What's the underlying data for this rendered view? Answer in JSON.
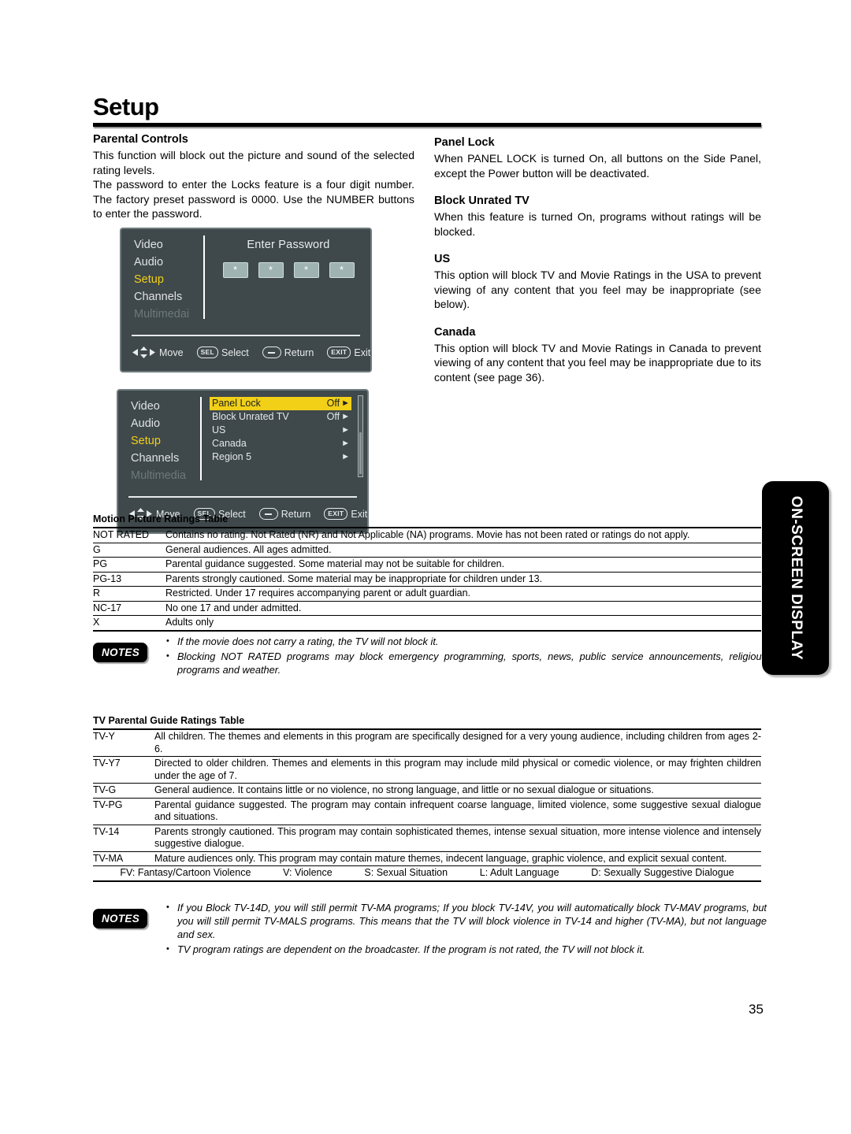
{
  "page": {
    "title": "Setup",
    "number": "35",
    "side_tab": "ON-SCREEN DISPLAY"
  },
  "left_column": {
    "heading": "Parental Controls",
    "para1": "This function will block out the picture and sound of the selected rating levels.",
    "para2": "The password to enter the Locks feature is a four digit number. The factory preset password is 0000. Use the NUMBER buttons to enter the password."
  },
  "right_column": {
    "sections": [
      {
        "heading": "Panel Lock",
        "body": "When PANEL LOCK is turned On, all buttons on the Side Panel, except the Power button will be deactivated."
      },
      {
        "heading": "Block Unrated TV",
        "body": "When this feature is turned On, programs without ratings will be blocked."
      },
      {
        "heading": "US",
        "body": "This option will block TV and Movie Ratings in the USA  to prevent viewing of any content that you feel may be inappropriate (see below)."
      },
      {
        "heading": "Canada",
        "body": "This option will block TV and Movie Ratings in Canada to prevent viewing of any content that you feel may be inappropriate due to its content (see page 36)."
      }
    ]
  },
  "osd_password": {
    "nav": [
      {
        "label": "Video",
        "state": "normal"
      },
      {
        "label": "Audio",
        "state": "normal"
      },
      {
        "label": "Setup",
        "state": "active"
      },
      {
        "label": "Channels",
        "state": "normal"
      },
      {
        "label": "Multimedai",
        "state": "dim"
      }
    ],
    "prompt": "Enter Password",
    "digits": [
      "*",
      "*",
      "*",
      "*"
    ],
    "footer": [
      {
        "key": "arrows",
        "label": "Move"
      },
      {
        "key": "SEL",
        "label": "Select"
      },
      {
        "key": "minus",
        "label": "Return"
      },
      {
        "key": "EXIT",
        "label": "Exit"
      }
    ],
    "accent_color": "#f2d018",
    "background_color": "#3f484b"
  },
  "osd_menu": {
    "nav": [
      {
        "label": "Video",
        "state": "normal"
      },
      {
        "label": "Audio",
        "state": "normal"
      },
      {
        "label": "Setup",
        "state": "active"
      },
      {
        "label": "Channels",
        "state": "normal"
      },
      {
        "label": "Multimedia",
        "state": "dim"
      }
    ],
    "items": [
      {
        "label": "Panel Lock",
        "value": "Off",
        "selected": true
      },
      {
        "label": "Block Unrated TV",
        "value": "Off",
        "selected": false
      },
      {
        "label": "US",
        "value": "",
        "selected": false
      },
      {
        "label": "Canada",
        "value": "",
        "selected": false
      },
      {
        "label": "Region 5",
        "value": "",
        "selected": false
      }
    ],
    "footer": [
      {
        "key": "arrows",
        "label": "Move"
      },
      {
        "key": "SEL",
        "label": "Select"
      },
      {
        "key": "minus",
        "label": "Return"
      },
      {
        "key": "EXIT",
        "label": "Exit"
      }
    ],
    "accent_color": "#f2d018",
    "background_color": "#3f484b"
  },
  "movie_table": {
    "caption": "Motion Picture Ratings Table",
    "rows": [
      {
        "code": "NOT RATED",
        "desc": "Contains no rating. Not Rated (NR) and Not Applicable (NA) programs. Movie has not been rated or ratings do not apply."
      },
      {
        "code": "G",
        "desc": "General audiences. All ages admitted."
      },
      {
        "code": "PG",
        "desc": "Parental guidance suggested. Some material may not be suitable for children."
      },
      {
        "code": "PG-13",
        "desc": "Parents strongly cautioned. Some material may be inappropriate for children under 13."
      },
      {
        "code": "R",
        "desc": "Restricted. Under 17 requires accompanying parent or adult guardian."
      },
      {
        "code": "NC-17",
        "desc": "No one 17 and under admitted."
      },
      {
        "code": "X",
        "desc": "Adults only"
      }
    ]
  },
  "notes_1": {
    "badge": "NOTES",
    "items": [
      "If the movie does not carry a rating, the TV will not block it.",
      "Blocking NOT RATED programs may block emergency programming, sports, news, public service announcements, religious programs and weather."
    ]
  },
  "tv_table": {
    "caption": "TV Parental Guide Ratings Table",
    "rows": [
      {
        "code": "TV-Y",
        "desc": "All children. The themes and elements in this program are specifically designed for a very young audience, including children from ages 2-6."
      },
      {
        "code": "TV-Y7",
        "desc": "Directed to older children. Themes and elements in this program may include mild physical or comedic violence, or may frighten children under the age of 7."
      },
      {
        "code": "TV-G",
        "desc": "General audience. It contains little or no violence, no strong language, and little or no sexual dialogue or situations."
      },
      {
        "code": "TV-PG",
        "desc": "Parental guidance suggested. The program may contain infrequent coarse language, limited violence, some suggestive sexual dialogue and situations."
      },
      {
        "code": "TV-14",
        "desc": "Parents strongly cautioned. This program may contain sophisticated themes, intense sexual situation, more intense violence and intensely suggestive dialogue."
      },
      {
        "code": "TV-MA",
        "desc": "Mature audiences only. This program may contain mature themes, indecent language, graphic violence, and explicit sexual content."
      }
    ],
    "legend": [
      "FV: Fantasy/Cartoon Violence",
      "V: Violence",
      "S: Sexual Situation",
      "L: Adult Language",
      "D: Sexually Suggestive Dialogue"
    ]
  },
  "notes_2": {
    "badge": "NOTES",
    "items": [
      "If you Block TV-14D, you will still permit TV-MA programs; If you block TV-14V, you will automatically block TV-MAV programs, but you will still permit TV-MALS programs. This means that the TV will block violence in TV-14 and higher (TV-MA), but not language and sex.",
      "TV program ratings are dependent on the broadcaster. If the program is not rated, the TV will not block it."
    ]
  }
}
